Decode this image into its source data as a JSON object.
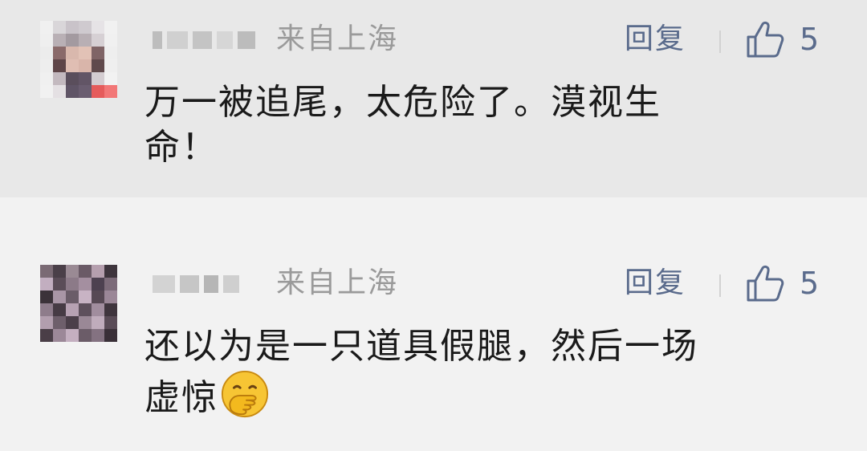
{
  "comments": [
    {
      "location": "来自上海",
      "reply_label": "回复",
      "like_count": "5",
      "text_line1": "万一被追尾，太危险了。漠视生",
      "text_line2": "命！",
      "avatar_icon": "pixelated-avatar",
      "nickname_state": "blurred"
    },
    {
      "location": "来自上海",
      "reply_label": "回复",
      "like_count": "5",
      "text_line1": "还以为是一只道具假腿，然后一场",
      "text_line2": "虚惊",
      "avatar_icon": "pixelated-avatar",
      "nickname_state": "blurred",
      "emoji": "hand-over-mouth-emoji"
    }
  ],
  "colors": {
    "accent": "#5a6b8c",
    "muted_text": "#9a9a9a",
    "highlight_bg": "#e8e8e8",
    "page_bg": "#f2f2f2"
  }
}
